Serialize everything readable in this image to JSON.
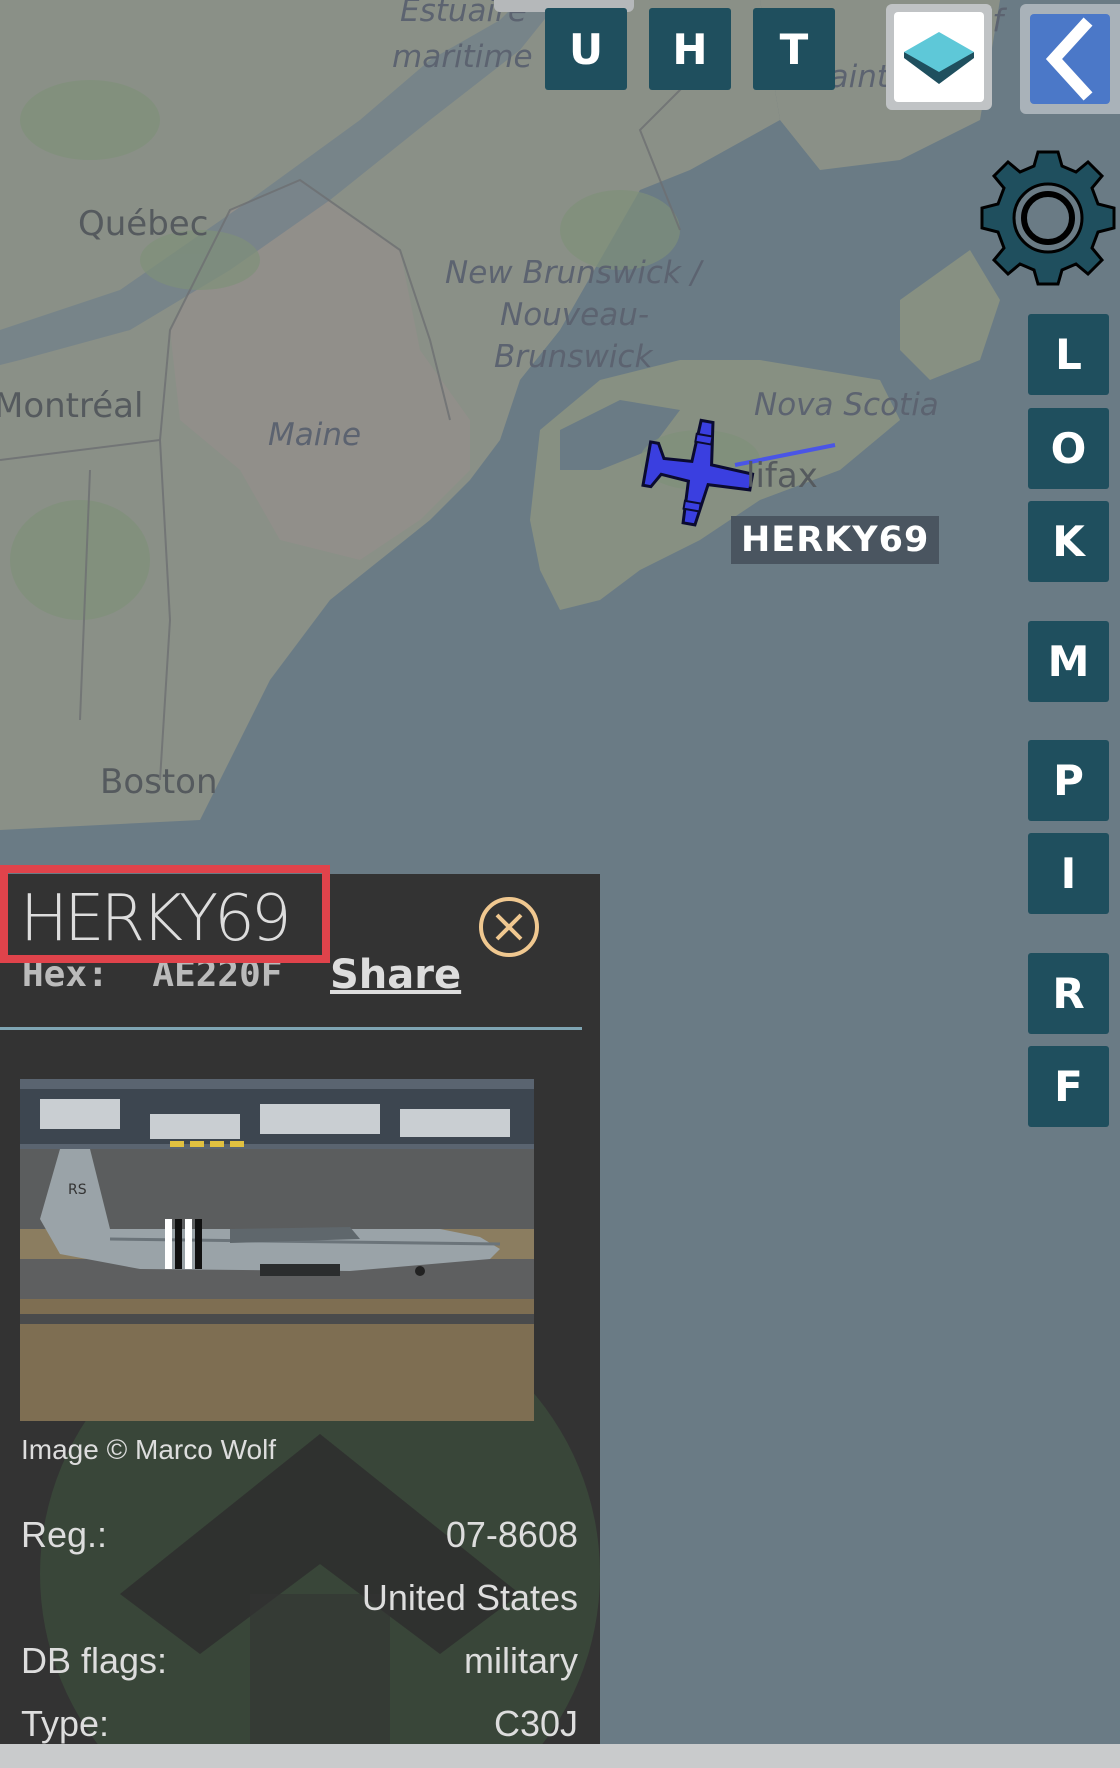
{
  "map": {
    "labels": {
      "estuaire": "Estuaire",
      "maritime": "maritime",
      "quebec": "Québec",
      "new_brunswick_1": "New Brunswick /",
      "new_brunswick_2": "Nouveau-",
      "new_brunswick_3": "Brunswick",
      "montreal": "Montréal",
      "maine": "Maine",
      "nova_scotia": "Nova Scotia",
      "halifax": "lifax",
      "boston": "Boston",
      "saint": "Saint",
      "gulf": "Gulf"
    },
    "aircraft_label": "HERKY69",
    "aircraft_color": "#3a3fe0"
  },
  "top_buttons": [
    "U",
    "H",
    "T"
  ],
  "side_buttons": [
    "L",
    "O",
    "K",
    "M",
    "P",
    "I",
    "R",
    "F"
  ],
  "panel": {
    "callsign": "HERKY69",
    "hex_label": "Hex:",
    "hex_value": "AE220F",
    "share_label": "Share",
    "image_credit": "Image © Marco Wolf",
    "rows": [
      {
        "label": "Reg.:",
        "value": "07-8608"
      },
      {
        "label": "",
        "value": "United States"
      },
      {
        "label": "DB flags:",
        "value": "military"
      },
      {
        "label": "Type:",
        "value": "C30J"
      }
    ],
    "photo_marking": "RS"
  },
  "colors": {
    "button_bg": "#1f4f5e",
    "highlight": "#e0434b",
    "panel_bg": "#333333"
  }
}
